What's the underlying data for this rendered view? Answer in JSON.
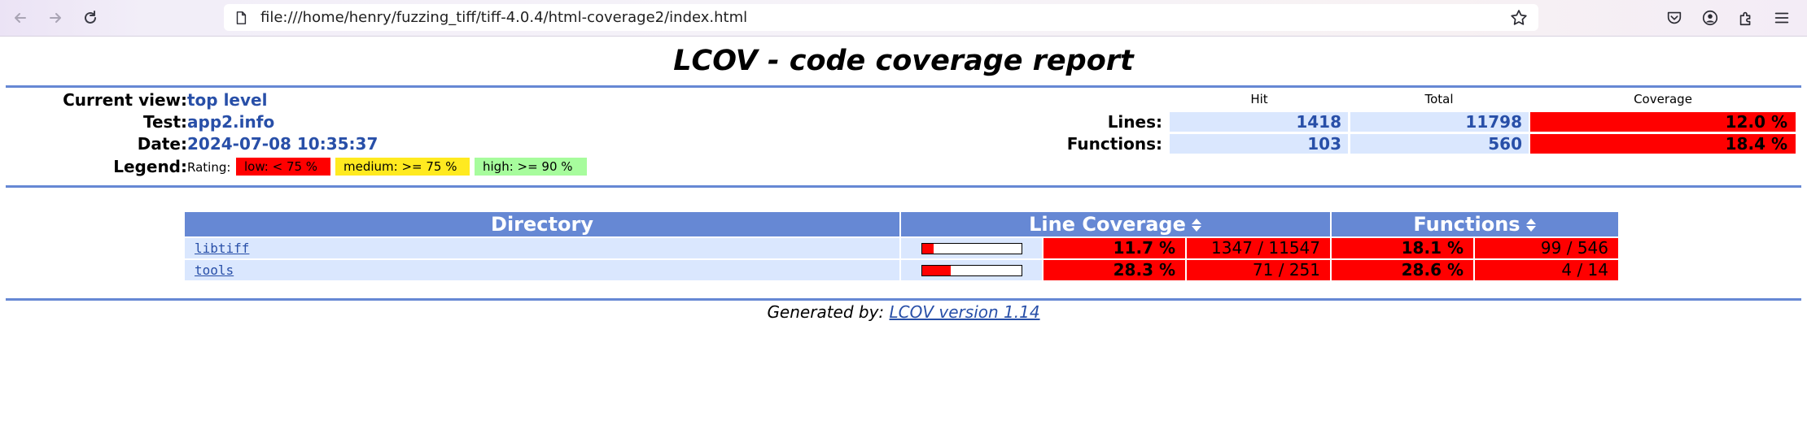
{
  "browser": {
    "url": "file:///home/henry/fuzzing_tiff/tiff-4.0.4/html-coverage2/index.html"
  },
  "report": {
    "title": "LCOV - code coverage report",
    "header": {
      "current_view_label": "Current view:",
      "current_view_value": "top level",
      "test_label": "Test:",
      "test_value": "app2.info",
      "date_label": "Date:",
      "date_value": "2024-07-08 10:35:37",
      "legend_label": "Legend:",
      "legend_rating": "Rating:",
      "legend_low": "low: < 75 %",
      "legend_medium": "medium: >= 75 %",
      "legend_high": "high: >= 90 %"
    },
    "summary": {
      "col_hit": "Hit",
      "col_total": "Total",
      "col_coverage": "Coverage",
      "lines_label": "Lines:",
      "lines_hit": "1418",
      "lines_total": "11798",
      "lines_coverage": "12.0 %",
      "functions_label": "Functions:",
      "functions_hit": "103",
      "functions_total": "560",
      "functions_coverage": "18.4 %"
    },
    "table": {
      "col_directory": "Directory",
      "col_line_coverage": "Line Coverage",
      "col_functions": "Functions",
      "rows": [
        {
          "name": "libtiff",
          "line_pct": "11.7 %",
          "line_ratio": "1347 / 11547",
          "fn_pct": "18.1 %",
          "fn_ratio": "99 / 546",
          "bar_fraction": 0.117
        },
        {
          "name": "tools",
          "line_pct": "28.3 %",
          "line_ratio": "71 / 251",
          "fn_pct": "28.6 %",
          "fn_ratio": "4 / 14",
          "bar_fraction": 0.283
        }
      ]
    },
    "footer": {
      "generated_by": "Generated by: ",
      "lcov_link": "LCOV version 1.14"
    }
  },
  "colors": {
    "header_blue": "#6688d4",
    "value_blue": "#284fa8",
    "cell_bg": "#dae7fe",
    "low_red": "#ff0000",
    "medium_yellow": "#ffea20",
    "high_green": "#a7fc9d"
  }
}
